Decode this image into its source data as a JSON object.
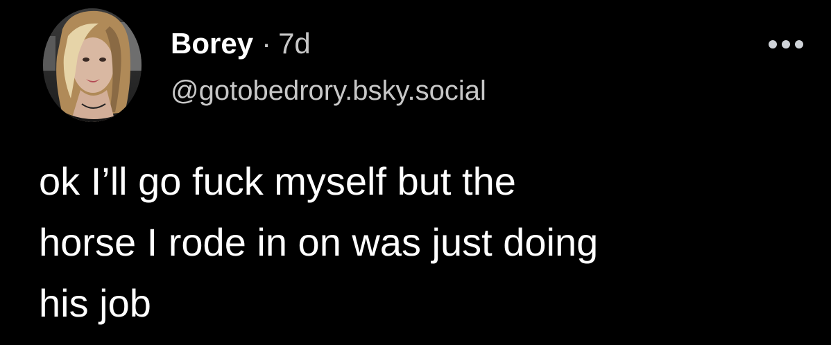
{
  "post": {
    "author": {
      "display_name": "Borey",
      "separator": "·",
      "timestamp": "7d",
      "handle": "@gotobedrory.bsky.social",
      "avatar_icon": "profile-photo"
    },
    "more_icon": "ellipsis-icon",
    "text_lines": [
      "ok I’ll go fuck myself but the",
      "horse I rode in on was just doing",
      "his job"
    ]
  },
  "colors": {
    "background": "#000000",
    "primary_text": "#ffffff",
    "secondary_text": "#c7c7c7",
    "icon": "#cfd3d8"
  }
}
